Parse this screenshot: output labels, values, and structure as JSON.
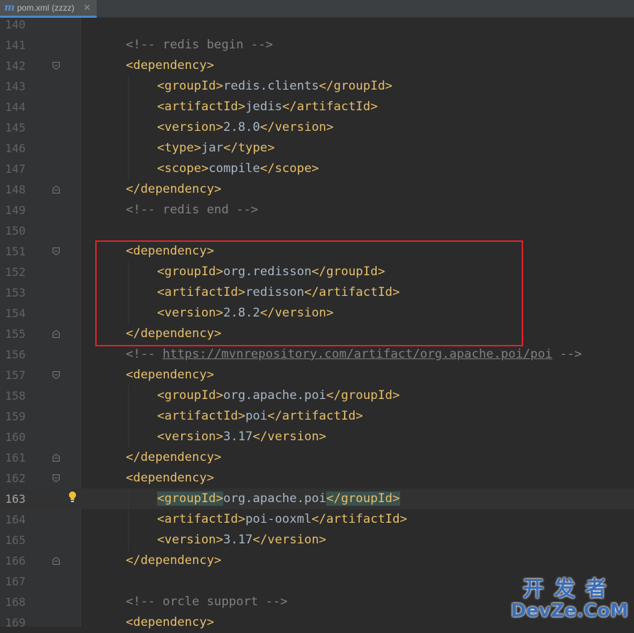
{
  "tab": {
    "icon": "maven-m-icon",
    "icon_glyph": "m",
    "label": "pom.xml (zzzz)",
    "close_glyph": "✕"
  },
  "current_line": 163,
  "lines": [
    {
      "n": "140",
      "indent": 0,
      "parts": []
    },
    {
      "n": "141",
      "indent": 0,
      "parts": [
        {
          "t": "cmt",
          "v": "<!-- redis begin -->"
        }
      ]
    },
    {
      "n": "142",
      "indent": 0,
      "fold": "open",
      "parts": [
        {
          "t": "tag",
          "v": "<dependency>"
        }
      ]
    },
    {
      "n": "143",
      "indent": 1,
      "parts": [
        {
          "t": "tag",
          "v": "<groupId>"
        },
        {
          "t": "txt",
          "v": "redis.clients"
        },
        {
          "t": "tag",
          "v": "</groupId>"
        }
      ]
    },
    {
      "n": "144",
      "indent": 1,
      "parts": [
        {
          "t": "tag",
          "v": "<artifactId>"
        },
        {
          "t": "txt",
          "v": "jedis"
        },
        {
          "t": "tag",
          "v": "</artifactId>"
        }
      ]
    },
    {
      "n": "145",
      "indent": 1,
      "parts": [
        {
          "t": "tag",
          "v": "<version>"
        },
        {
          "t": "txt",
          "v": "2.8.0"
        },
        {
          "t": "tag",
          "v": "</version>"
        }
      ]
    },
    {
      "n": "146",
      "indent": 1,
      "parts": [
        {
          "t": "tag",
          "v": "<type>"
        },
        {
          "t": "txt",
          "v": "jar"
        },
        {
          "t": "tag",
          "v": "</type>"
        }
      ]
    },
    {
      "n": "147",
      "indent": 1,
      "parts": [
        {
          "t": "tag",
          "v": "<scope>"
        },
        {
          "t": "txt",
          "v": "compile"
        },
        {
          "t": "tag",
          "v": "</scope>"
        }
      ]
    },
    {
      "n": "148",
      "indent": 0,
      "fold": "close",
      "parts": [
        {
          "t": "tag",
          "v": "</dependency>"
        }
      ]
    },
    {
      "n": "149",
      "indent": 0,
      "parts": [
        {
          "t": "cmt",
          "v": "<!-- redis end -->"
        }
      ]
    },
    {
      "n": "150",
      "indent": 0,
      "parts": []
    },
    {
      "n": "151",
      "indent": 0,
      "fold": "open",
      "parts": [
        {
          "t": "tag",
          "v": "<dependency>"
        }
      ]
    },
    {
      "n": "152",
      "indent": 1,
      "parts": [
        {
          "t": "tag",
          "v": "<groupId>"
        },
        {
          "t": "txt",
          "v": "org.redisson"
        },
        {
          "t": "tag",
          "v": "</groupId>"
        }
      ]
    },
    {
      "n": "153",
      "indent": 1,
      "parts": [
        {
          "t": "tag",
          "v": "<artifactId>"
        },
        {
          "t": "txt",
          "v": "redisson"
        },
        {
          "t": "tag",
          "v": "</artifactId>"
        }
      ]
    },
    {
      "n": "154",
      "indent": 1,
      "parts": [
        {
          "t": "tag",
          "v": "<version>"
        },
        {
          "t": "txt",
          "v": "2.8.2"
        },
        {
          "t": "tag",
          "v": "</version>"
        }
      ]
    },
    {
      "n": "155",
      "indent": 0,
      "fold": "close",
      "parts": [
        {
          "t": "tag",
          "v": "</dependency>"
        }
      ]
    },
    {
      "n": "156",
      "indent": 0,
      "parts": [
        {
          "t": "cmt",
          "v": "<!-- "
        },
        {
          "t": "link",
          "v": "https://mvnrepository.com/artifact/org.apache.poi/poi"
        },
        {
          "t": "cmt",
          "v": " -->"
        }
      ]
    },
    {
      "n": "157",
      "indent": 0,
      "fold": "open",
      "parts": [
        {
          "t": "tag",
          "v": "<dependency>"
        }
      ]
    },
    {
      "n": "158",
      "indent": 1,
      "parts": [
        {
          "t": "tag",
          "v": "<groupId>"
        },
        {
          "t": "txt",
          "v": "org.apache.poi"
        },
        {
          "t": "tag",
          "v": "</groupId>"
        }
      ]
    },
    {
      "n": "159",
      "indent": 1,
      "parts": [
        {
          "t": "tag",
          "v": "<artifactId>"
        },
        {
          "t": "txt",
          "v": "poi"
        },
        {
          "t": "tag",
          "v": "</artifactId>"
        }
      ]
    },
    {
      "n": "160",
      "indent": 1,
      "parts": [
        {
          "t": "tag",
          "v": "<version>"
        },
        {
          "t": "txt",
          "v": "3.17"
        },
        {
          "t": "tag",
          "v": "</version>"
        }
      ]
    },
    {
      "n": "161",
      "indent": 0,
      "fold": "close",
      "parts": [
        {
          "t": "tag",
          "v": "</dependency>"
        }
      ]
    },
    {
      "n": "162",
      "indent": 0,
      "fold": "open",
      "parts": [
        {
          "t": "tag",
          "v": "<dependency>"
        }
      ]
    },
    {
      "n": "163",
      "indent": 1,
      "bulb": true,
      "parts": [
        {
          "t": "tag-hl",
          "v": "<groupId>"
        },
        {
          "t": "txt",
          "v": "org.apache.poi"
        },
        {
          "t": "tag-hl",
          "v": "</groupId>"
        }
      ]
    },
    {
      "n": "164",
      "indent": 1,
      "parts": [
        {
          "t": "tag",
          "v": "<artifactId>"
        },
        {
          "t": "txt",
          "v": "poi-ooxml"
        },
        {
          "t": "tag",
          "v": "</artifactId>"
        }
      ]
    },
    {
      "n": "165",
      "indent": 1,
      "parts": [
        {
          "t": "tag",
          "v": "<version>"
        },
        {
          "t": "txt",
          "v": "3.17"
        },
        {
          "t": "tag",
          "v": "</version>"
        }
      ]
    },
    {
      "n": "166",
      "indent": 0,
      "fold": "close",
      "parts": [
        {
          "t": "tag",
          "v": "</dependency>"
        }
      ]
    },
    {
      "n": "167",
      "indent": 0,
      "parts": []
    },
    {
      "n": "168",
      "indent": 0,
      "parts": [
        {
          "t": "cmt",
          "v": "<!-- orcle support -->"
        }
      ]
    },
    {
      "n": "169",
      "indent": 0,
      "parts": [
        {
          "t": "tag",
          "v": "<dependency>"
        }
      ]
    }
  ],
  "watermark": {
    "top": "开发者",
    "bottom": "DevZe.CoM"
  },
  "colors": {
    "tag": "#e8bf6a",
    "text": "#a9b7c6",
    "comment": "#808080",
    "highlight_box": "#e0242b",
    "background": "#2b2b2b"
  }
}
